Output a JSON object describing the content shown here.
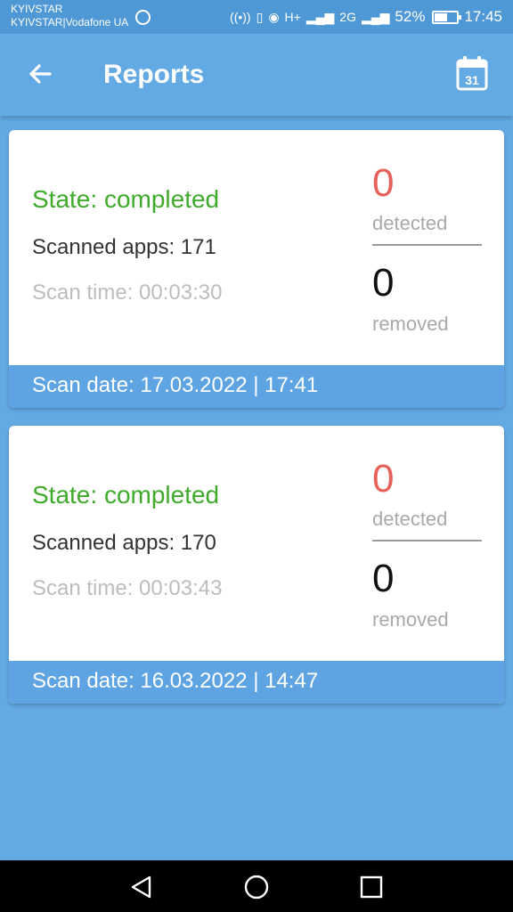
{
  "status_bar": {
    "carrier_line1": "KYIVSTAR",
    "carrier_line2": "KYIVSTAR|Vodafone UA",
    "network1": "H+",
    "network2": "2G",
    "battery_percent": "52%",
    "battery_level": 0.52,
    "time": "17:45",
    "icons": [
      "sync-icon",
      "hotspot-icon",
      "vibrate-icon",
      "eye-comfort-icon",
      "signal-icon",
      "signal-icon",
      "battery-icon"
    ]
  },
  "app_bar": {
    "title": "Reports",
    "back_icon": "arrow-left-icon",
    "calendar_icon": "calendar-icon",
    "calendar_day": "31"
  },
  "reports": [
    {
      "state": "State: completed",
      "scanned_apps": "Scanned apps: 171",
      "scan_time": "Scan time: 00:03:30",
      "detected_count": "0",
      "detected_label": "detected",
      "removed_count": "0",
      "removed_label": "removed",
      "scan_date": "Scan date: 17.03.2022 | 17:41"
    },
    {
      "state": "State: completed",
      "scanned_apps": "Scanned apps: 170",
      "scan_time": "Scan time: 00:03:43",
      "detected_count": "0",
      "detected_label": "detected",
      "removed_count": "0",
      "removed_label": "removed",
      "scan_date": "Scan date: 16.03.2022 | 14:47"
    }
  ],
  "nav_bar": {
    "icons": [
      "back-triangle-icon",
      "home-circle-icon",
      "recents-square-icon"
    ]
  },
  "colors": {
    "primary": "#63a9e4",
    "status_bar": "#4f98d6",
    "state_completed": "#3faa2c",
    "detected": "#e5615a",
    "footer": "#5ea4e2"
  }
}
